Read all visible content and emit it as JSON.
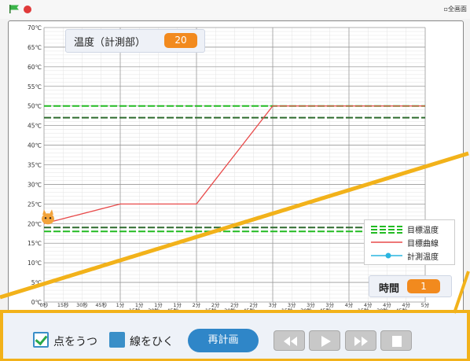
{
  "topbar": {
    "fullscreen_alt": "全画面"
  },
  "temperature": {
    "label": "温度（計測部）",
    "value": "20"
  },
  "time": {
    "label": "時間",
    "value": "1"
  },
  "legend": {
    "target_temp": "目標温度",
    "target_curve": "目標曲線",
    "measured_temp": "計測温度"
  },
  "controls": {
    "plot_points": "点をうつ",
    "draw_line": "線をひく",
    "recalc": "再計画"
  },
  "colors": {
    "accent_orange": "#f28a1e",
    "button_blue": "#2f86c8",
    "target_green": "#22bb22",
    "dark_green": "#2e6b2e",
    "curve_red": "#e84a4a",
    "measured_cyan": "#2ab5e0",
    "highlight_yellow": "#f2b21a"
  },
  "chart_data": {
    "type": "line",
    "ylim": [
      0,
      70
    ],
    "yticks": [
      "0℃",
      "5℃",
      "10℃",
      "15℃",
      "20℃",
      "25℃",
      "30℃",
      "35℃",
      "40℃",
      "45℃",
      "50℃",
      "55℃",
      "60℃",
      "65℃",
      "70℃"
    ],
    "xlabels_top": [
      "0秒",
      "15秒",
      "30秒",
      "45秒",
      "1分",
      "1分",
      "1分",
      "1分",
      "2分",
      "2分",
      "2分",
      "2分",
      "3分",
      "3分",
      "3分",
      "3分",
      "4分",
      "4分",
      "4分",
      "4分",
      "5分"
    ],
    "xlabels_bottom": [
      "15秒",
      "30秒",
      "45秒",
      "15秒",
      "30秒",
      "45秒",
      "15秒",
      "30秒",
      "45秒",
      "15秒",
      "30秒",
      "45秒"
    ],
    "x_minutes": [
      0,
      1,
      2,
      3,
      4,
      5
    ],
    "series": [
      {
        "name": "目標曲線",
        "x": [
          0,
          1,
          2,
          3,
          5
        ],
        "y": [
          20,
          25,
          25,
          50,
          50
        ]
      }
    ],
    "target_lines": [
      50,
      47,
      19,
      18
    ],
    "grid": true,
    "legend_position": "bottom-right"
  }
}
